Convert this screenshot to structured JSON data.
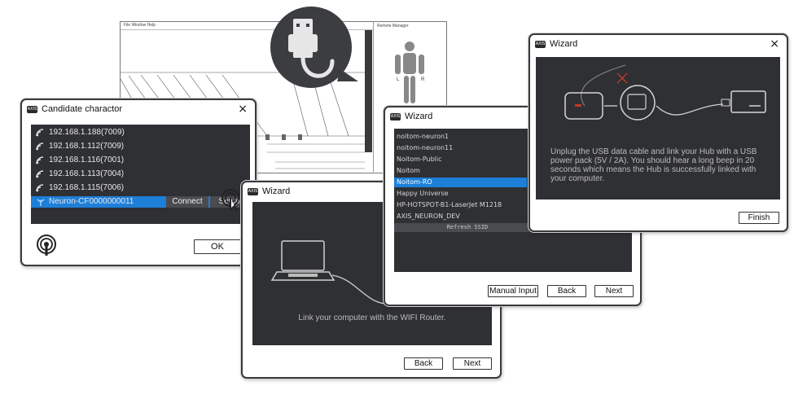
{
  "background_app": {
    "menu": "File   Window   Help",
    "panel_title": "Remote   Manager",
    "figure_left": "L",
    "figure_right": "R"
  },
  "candidate_window": {
    "title": "Candidate charactor",
    "close": "×",
    "items": [
      {
        "label": "192.168.1.188(7009)",
        "selected": false
      },
      {
        "label": "192.168.1.112(7009)",
        "selected": false
      },
      {
        "label": "192.168.1.116(7001)",
        "selected": false
      },
      {
        "label": "192.168.1.113(7004)",
        "selected": false
      },
      {
        "label": "192.168.1.115(7006)",
        "selected": false
      },
      {
        "label": "Neuron-CF0000000011",
        "selected": true
      }
    ],
    "connect_label": "Connect",
    "setup_label": "Setup",
    "ok_label": "OK"
  },
  "wizard_router": {
    "title": "Wizard",
    "caption": "Link your computer with the WIFI Router.",
    "back_label": "Back",
    "next_label": "Next"
  },
  "wizard_ssid": {
    "title": "Wizard",
    "networks": [
      "noitom-neuron1",
      "noitom-neuron11",
      "Noitom-Public",
      "Noitom",
      "Noitom-RO",
      "Happy Universe",
      "HP-HOTSPOT-B1-LaserJet M1218",
      "AXIS_NEURON_DEV"
    ],
    "selected_index": 4,
    "refresh_label": "Refresh SSID",
    "manual_label": "Manual Input",
    "back_label": "Back",
    "next_label": "Next"
  },
  "wizard_hub": {
    "title": "Wizard",
    "close": "×",
    "caption": "Unplug the USB data cable and link your Hub with a USB power pack (5V / 2A). You should hear a long beep in 20 seconds which means the Hub is successfully linked with your computer.",
    "finish_label": "Finish"
  },
  "colors": {
    "panel_bg": "#2f3033",
    "selection": "#1d7fd8",
    "window_border": "#3a3a3a"
  }
}
